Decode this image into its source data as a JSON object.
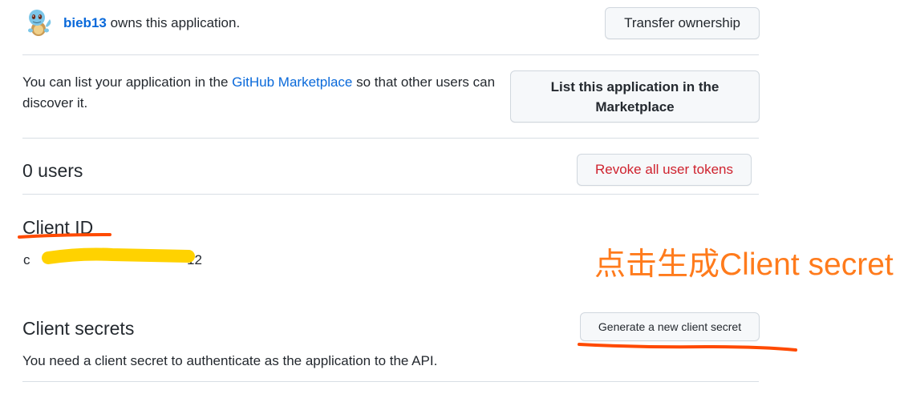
{
  "owner": {
    "username": "bieb13",
    "owns_text": "owns this application.",
    "transfer_button": "Transfer ownership"
  },
  "marketplace": {
    "text_before": "You can list your application in the ",
    "link": "GitHub Marketplace",
    "text_after": " so that other users can",
    "text_line2": "discover it.",
    "button_line1": "List this application in the",
    "button_line2": "Marketplace"
  },
  "users": {
    "count_label": "0 users",
    "revoke_button": "Revoke all user tokens"
  },
  "client_id": {
    "heading": "Client ID",
    "value_start": "c",
    "value_end": "12"
  },
  "client_secrets": {
    "heading": "Client secrets",
    "generate_button": "Generate a new client secret",
    "description": "You need a client secret to authenticate as the application to the API."
  },
  "annotation": {
    "text": "点击生成Client secret",
    "color": "#ff7b1c",
    "redaction_color": "#ffd200",
    "underline_color": "#ff4a00"
  },
  "colors": {
    "link": "#0969da",
    "danger": "#cf222e",
    "border": "#d0d7de"
  }
}
